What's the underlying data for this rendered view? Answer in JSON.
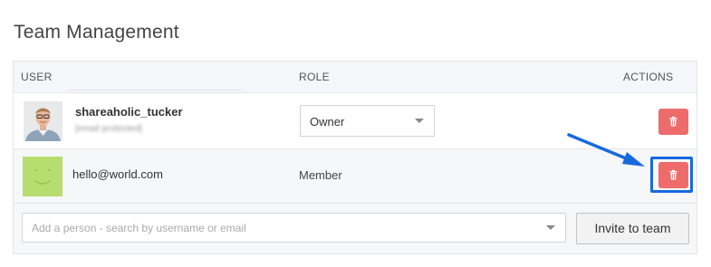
{
  "page": {
    "title": "Team Management"
  },
  "table": {
    "headers": {
      "user": "USER",
      "role": "ROLE",
      "actions": "ACTIONS"
    },
    "rows": [
      {
        "username": "shareaholic_tucker",
        "email": "[email protected]",
        "role": "Owner",
        "role_editable": true
      },
      {
        "username": "hello@world.com",
        "role": "Member",
        "role_editable": false
      }
    ]
  },
  "add_person": {
    "placeholder": "Add a person - search by username or email",
    "invite_label": "Invite to team"
  },
  "icons": {
    "delete": "trash-icon",
    "dropdown": "chevron-down-icon",
    "avatar_placeholder": "smiley-face-icon",
    "annotation": "arrow-icon"
  },
  "colors": {
    "delete_button": "#ee6b6b",
    "highlight_box": "#1769e0",
    "avatar_placeholder": "#b6dd6f",
    "header_bg": "#f4f6f9"
  }
}
